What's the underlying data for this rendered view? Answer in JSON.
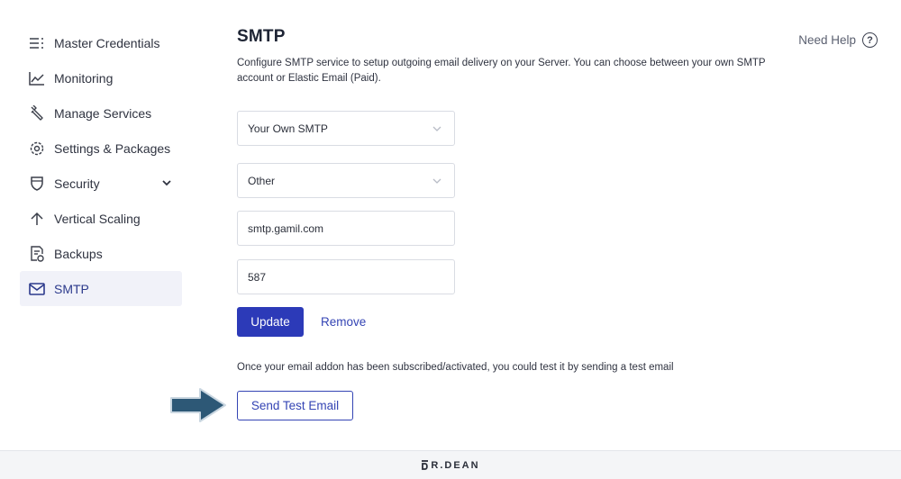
{
  "sidebar": {
    "items": [
      {
        "label": "Master Credentials",
        "icon": "list-icon"
      },
      {
        "label": "Monitoring",
        "icon": "chart-line-icon"
      },
      {
        "label": "Manage Services",
        "icon": "wrench-icon"
      },
      {
        "label": "Settings & Packages",
        "icon": "gear-icon"
      },
      {
        "label": "Security",
        "icon": "shield-icon"
      },
      {
        "label": "Vertical Scaling",
        "icon": "arrow-up-icon"
      },
      {
        "label": "Backups",
        "icon": "backup-file-icon"
      },
      {
        "label": "SMTP",
        "icon": "mail-icon"
      }
    ],
    "active": "SMTP"
  },
  "header": {
    "title": "SMTP",
    "description": "Configure SMTP service to setup outgoing email delivery on your Server. You can choose between your own SMTP account or Elastic Email (Paid).",
    "help_label": "Need Help",
    "help_icon": "help-circle-icon"
  },
  "form": {
    "provider_select": "Your Own SMTP",
    "service_select": "Other",
    "host_value": "smtp.gamil.com",
    "port_value": "587",
    "update_label": "Update",
    "remove_label": "Remove"
  },
  "test": {
    "note": "Once your email addon has been subscribed/activated, you could test it by sending a test email",
    "button_label": "Send Test Email"
  },
  "footer": {
    "brand": "R.DEAN"
  },
  "colors": {
    "accent": "#2c3ab8",
    "link": "#3444b4",
    "arrow": "#2d5876",
    "active_bg": "#f1f2f9"
  }
}
